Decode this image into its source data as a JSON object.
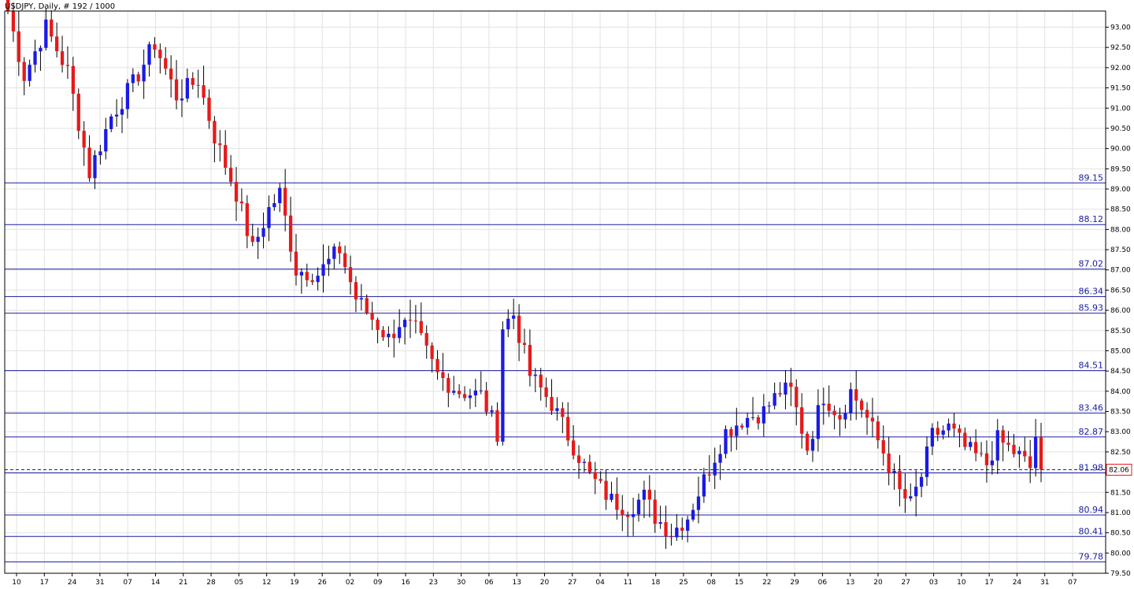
{
  "chart_data": {
    "type": "candlestick",
    "title": "USDJPY, Daily, # 192 / 1000",
    "ylim": [
      79.5,
      93.4
    ],
    "yticks": [
      "93.00",
      "92.50",
      "92.00",
      "91.50",
      "91.00",
      "90.50",
      "90.00",
      "89.50",
      "89.00",
      "88.50",
      "88.00",
      "87.50",
      "87.00",
      "86.50",
      "86.00",
      "85.50",
      "85.00",
      "84.50",
      "84.00",
      "83.50",
      "83.00",
      "82.50",
      "82.00",
      "81.50",
      "81.00",
      "80.50",
      "80.00",
      "79.50"
    ],
    "xticks": [
      "10",
      "17",
      "24",
      "31",
      "07",
      "14",
      "21",
      "28",
      "05",
      "12",
      "19",
      "26",
      "02",
      "09",
      "16",
      "23",
      "30",
      "06",
      "13",
      "20",
      "27",
      "04",
      "11",
      "18",
      "25",
      "08",
      "15",
      "22",
      "29",
      "06",
      "13",
      "20",
      "27",
      "03",
      "10",
      "17",
      "24",
      "31",
      "07"
    ],
    "levels": [
      {
        "label": "89.15",
        "value": 89.15
      },
      {
        "label": "88.12",
        "value": 88.12
      },
      {
        "label": "87.02",
        "value": 87.02
      },
      {
        "label": "86.34",
        "value": 86.34
      },
      {
        "label": "85.93",
        "value": 85.93
      },
      {
        "label": "84.51",
        "value": 84.51
      },
      {
        "label": "83.46",
        "value": 83.46
      },
      {
        "label": "82.87",
        "value": 82.87
      },
      {
        "label": "81.98",
        "value": 81.98
      },
      {
        "label": "80.94",
        "value": 80.94
      },
      {
        "label": "80.41",
        "value": 80.41
      },
      {
        "label": "79.78",
        "value": 79.78
      }
    ],
    "current_price": {
      "label": "82.06",
      "value": 82.06
    },
    "colors": {
      "up": "#1a1ae6",
      "down": "#e61a1a",
      "wick": "#000000",
      "grid": "#e2e2e2",
      "level": "#1c1ca0",
      "axis": "#000000"
    },
    "key_points": [
      [
        0,
        93.4
      ],
      [
        3,
        91.8
      ],
      [
        7,
        93.0
      ],
      [
        11,
        91.9
      ],
      [
        15,
        89.4
      ],
      [
        19,
        90.8
      ],
      [
        23,
        91.6
      ],
      [
        27,
        92.6
      ],
      [
        31,
        91.3
      ],
      [
        35,
        91.7
      ],
      [
        38,
        90.3
      ],
      [
        42,
        88.9
      ],
      [
        45,
        87.5
      ],
      [
        48,
        88.5
      ],
      [
        50,
        88.9
      ],
      [
        53,
        87.0
      ],
      [
        57,
        86.9
      ],
      [
        61,
        87.5
      ],
      [
        64,
        86.3
      ],
      [
        67,
        85.8
      ],
      [
        70,
        85.3
      ],
      [
        72,
        85.7
      ],
      [
        75,
        85.5
      ],
      [
        79,
        84.4
      ],
      [
        83,
        84.0
      ],
      [
        87,
        83.9
      ],
      [
        90,
        83.0
      ],
      [
        91,
        85.6
      ],
      [
        93,
        85.9
      ],
      [
        96,
        84.4
      ],
      [
        100,
        83.7
      ],
      [
        103,
        82.9
      ],
      [
        107,
        81.9
      ],
      [
        111,
        81.3
      ],
      [
        114,
        81.1
      ],
      [
        117,
        81.4
      ],
      [
        119,
        80.9
      ],
      [
        122,
        80.5
      ],
      [
        125,
        80.9
      ],
      [
        128,
        81.8
      ],
      [
        132,
        83.0
      ],
      [
        135,
        83.3
      ],
      [
        139,
        83.5
      ],
      [
        142,
        84.0
      ],
      [
        144,
        84.0
      ],
      [
        147,
        82.6
      ],
      [
        150,
        83.9
      ],
      [
        153,
        83.4
      ],
      [
        155,
        84.0
      ],
      [
        157,
        83.6
      ],
      [
        161,
        82.5
      ],
      [
        164,
        81.5
      ],
      [
        166,
        81.2
      ],
      [
        168,
        81.9
      ],
      [
        170,
        82.9
      ],
      [
        173,
        83.1
      ],
      [
        176,
        82.6
      ],
      [
        180,
        82.2
      ],
      [
        182,
        82.8
      ],
      [
        186,
        82.4
      ],
      [
        188,
        82.1
      ],
      [
        189,
        82.9
      ],
      [
        190,
        82.06
      ]
    ]
  }
}
